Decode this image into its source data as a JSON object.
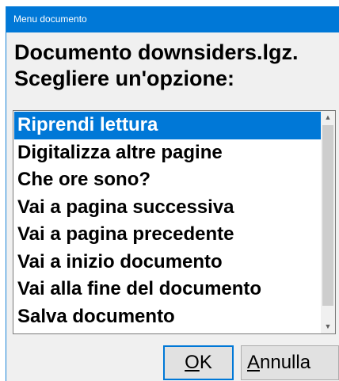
{
  "window": {
    "title": "Menu documento"
  },
  "prompt": {
    "line1": "Documento downsiders.lgz.",
    "line2": "Scegliere un'opzione:"
  },
  "list": {
    "items": [
      "Riprendi lettura",
      "Digitalizza altre pagine",
      "Che ore sono?",
      "Vai a pagina successiva",
      "Vai a pagina precedente",
      "Vai a inizio documento",
      "Vai alla fine del documento",
      "Salva documento"
    ],
    "selected_index": 0,
    "scroll_up_icon": "chevron-up-icon",
    "scroll_down_icon": "chevron-down-icon"
  },
  "buttons": {
    "ok": {
      "mnemonic": "O",
      "rest": "K"
    },
    "cancel": {
      "mnemonic": "A",
      "rest": "nnulla"
    }
  },
  "colors": {
    "accent": "#0078d7",
    "dialog_bg": "#f0f0f0",
    "list_bg": "#ffffff"
  }
}
